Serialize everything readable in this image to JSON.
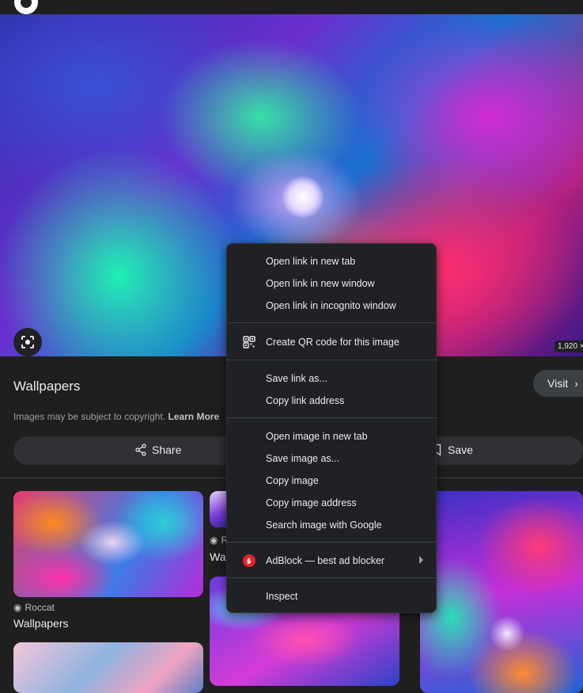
{
  "hero": {
    "dimensions_label": "1,920 ×"
  },
  "result": {
    "title": "Wallpapers",
    "visit_label": "Visit",
    "copyright_text": "Images may be subject to copyright.",
    "learn_more_label": "Learn More",
    "share_label": "Share",
    "save_label": "Save"
  },
  "related": [
    {
      "source": "Roccat",
      "title": "Wallpapers"
    },
    {
      "source": "R",
      "title": "Wa"
    }
  ],
  "context_menu": {
    "items": [
      {
        "label": "Open link in new tab"
      },
      {
        "label": "Open link in new window"
      },
      {
        "label": "Open link in incognito window"
      },
      {
        "label": "Create QR code for this image",
        "icon": "qr-code-icon"
      },
      {
        "label": "Save link as..."
      },
      {
        "label": "Copy link address"
      },
      {
        "label": "Open image in new tab"
      },
      {
        "label": "Save image as..."
      },
      {
        "label": "Copy image"
      },
      {
        "label": "Copy image address"
      },
      {
        "label": "Search image with Google"
      },
      {
        "label": "AdBlock — best ad blocker",
        "icon": "adblock-icon",
        "has_submenu": true
      },
      {
        "label": "Inspect"
      }
    ]
  },
  "colors": {
    "background": "#1f1f1f",
    "menu_background": "#202124",
    "text": "#e8eaed",
    "muted_text": "#9aa0a6",
    "adblock_red": "#e5252a"
  }
}
